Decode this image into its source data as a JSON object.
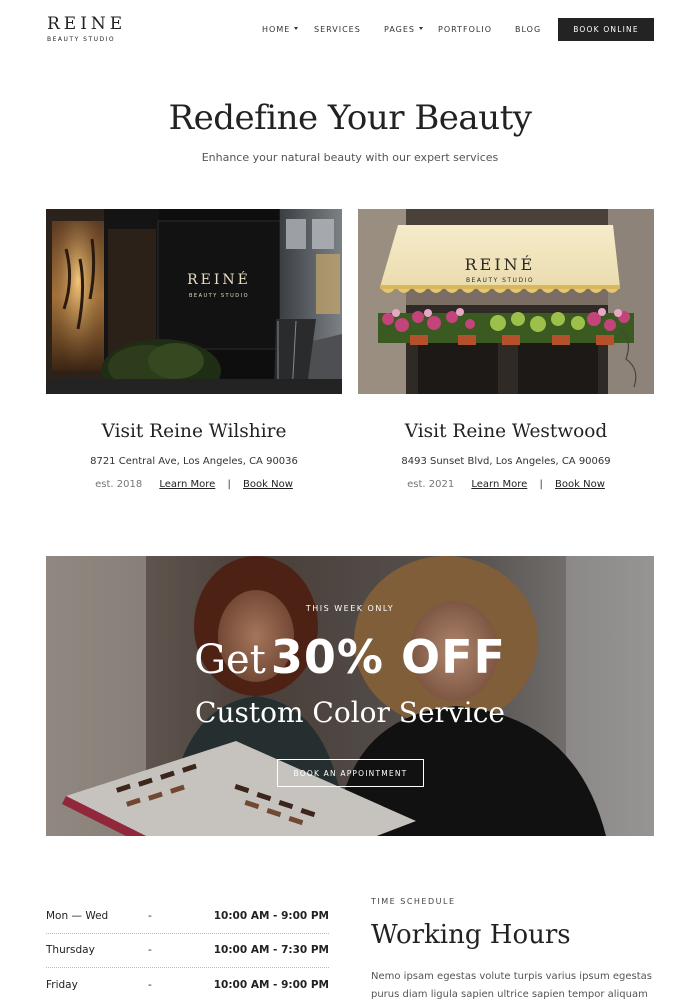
{
  "brand": {
    "name": "REINE",
    "tagline": "BEAUTY STUDIO"
  },
  "nav": {
    "items": [
      {
        "label": "HOME",
        "has_dropdown": true
      },
      {
        "label": "SERVICES",
        "has_dropdown": false
      },
      {
        "label": "PAGES",
        "has_dropdown": true
      },
      {
        "label": "PORTFOLIO",
        "has_dropdown": false
      },
      {
        "label": "BLOG",
        "has_dropdown": false
      }
    ],
    "cta_label": "BOOK ONLINE"
  },
  "hero": {
    "title": "Redefine Your Beauty",
    "subtitle": "Enhance your natural beauty with our expert services"
  },
  "locations": [
    {
      "title": "Visit Reine Wilshire",
      "address": "8721 Central Ave, Los Angeles, CA 90036",
      "established": "est. 2018",
      "learn_more": "Learn More",
      "separator": "|",
      "book_now": "Book Now",
      "sign_text": "REINÉ",
      "sign_sub": "BEAUTY STUDIO"
    },
    {
      "title": "Visit Reine Westwood",
      "address": "8493 Sunset Blvd, Los Angeles, CA 90069",
      "established": "est. 2021",
      "learn_more": "Learn More",
      "separator": "|",
      "book_now": "Book Now",
      "sign_text": "REINÉ",
      "sign_sub": "BEAUTY STUDIO"
    }
  ],
  "promo": {
    "eyebrow": "THIS WEEK ONLY",
    "get": "Get",
    "discount": "30% OFF",
    "service": "Custom Color Service",
    "button_label": "BOOK AN APPOINTMENT"
  },
  "hours": [
    {
      "day": "Mon — Wed",
      "dash": "-",
      "time": "10:00 AM - 9:00 PM"
    },
    {
      "day": "Thursday",
      "dash": "-",
      "time": "10:00 AM - 7:30 PM"
    },
    {
      "day": "Friday",
      "dash": "-",
      "time": "10:00 AM - 9:00 PM"
    }
  ],
  "schedule": {
    "eyebrow": "TIME SCHEDULE",
    "title": "Working Hours",
    "body": "Nemo ipsam egestas volute turpis varius ipsum egestas purus diam ligula sapien ultrice sapien tempor aliquam tortor ipsum"
  },
  "colors": {
    "dark": "#232323",
    "text": "#222222",
    "muted": "#555555",
    "white": "#ffffff"
  }
}
